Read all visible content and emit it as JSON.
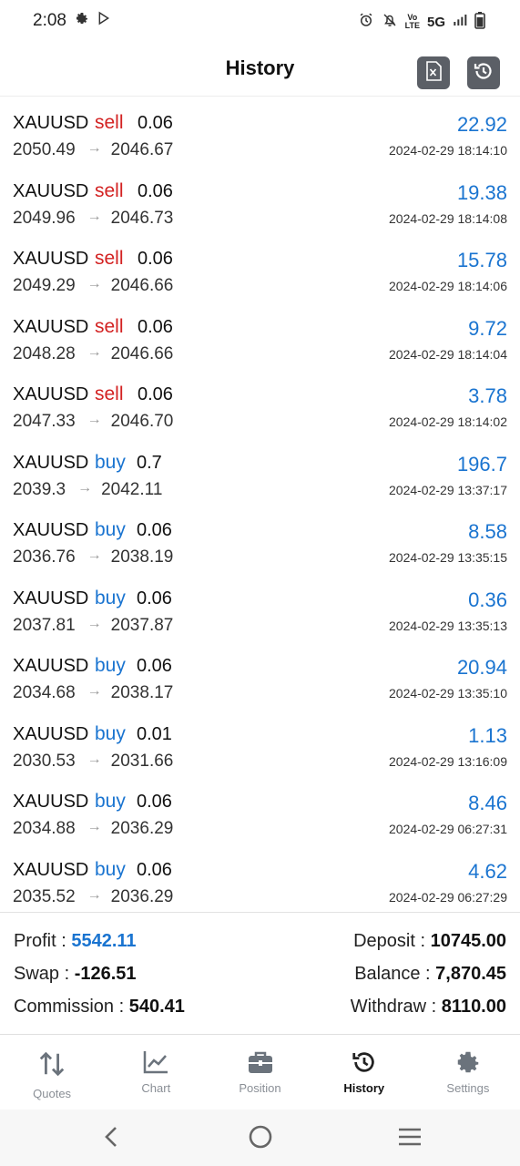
{
  "status_bar": {
    "time": "2:08",
    "network": "5G",
    "volte": "Vo\nLTE",
    "icons": [
      "gear-icon",
      "play-store-icon",
      "alarm-icon",
      "mute-icon",
      "volte-icon",
      "signal-icon",
      "battery-icon"
    ]
  },
  "header": {
    "title": "History",
    "buttons": [
      "export-excel-icon",
      "history-icon"
    ]
  },
  "colors": {
    "sell": "#d32222",
    "buy": "#1a74d0",
    "profit": "#1a74d0",
    "header_button": "#5b5f66"
  },
  "trades": [
    {
      "symbol": "XAUUSD",
      "side": "sell",
      "volume": "0.06",
      "open": "2050.49",
      "close": "2046.67",
      "profit": "22.92",
      "time": "2024-02-29 18:14:10"
    },
    {
      "symbol": "XAUUSD",
      "side": "sell",
      "volume": "0.06",
      "open": "2049.96",
      "close": "2046.73",
      "profit": "19.38",
      "time": "2024-02-29 18:14:08"
    },
    {
      "symbol": "XAUUSD",
      "side": "sell",
      "volume": "0.06",
      "open": "2049.29",
      "close": "2046.66",
      "profit": "15.78",
      "time": "2024-02-29 18:14:06"
    },
    {
      "symbol": "XAUUSD",
      "side": "sell",
      "volume": "0.06",
      "open": "2048.28",
      "close": "2046.66",
      "profit": "9.72",
      "time": "2024-02-29 18:14:04"
    },
    {
      "symbol": "XAUUSD",
      "side": "sell",
      "volume": "0.06",
      "open": "2047.33",
      "close": "2046.70",
      "profit": "3.78",
      "time": "2024-02-29 18:14:02"
    },
    {
      "symbol": "XAUUSD",
      "side": "buy",
      "volume": "0.7",
      "open": "2039.3",
      "close": "2042.11",
      "profit": "196.7",
      "time": "2024-02-29 13:37:17"
    },
    {
      "symbol": "XAUUSD",
      "side": "buy",
      "volume": "0.06",
      "open": "2036.76",
      "close": "2038.19",
      "profit": "8.58",
      "time": "2024-02-29 13:35:15"
    },
    {
      "symbol": "XAUUSD",
      "side": "buy",
      "volume": "0.06",
      "open": "2037.81",
      "close": "2037.87",
      "profit": "0.36",
      "time": "2024-02-29 13:35:13"
    },
    {
      "symbol": "XAUUSD",
      "side": "buy",
      "volume": "0.06",
      "open": "2034.68",
      "close": "2038.17",
      "profit": "20.94",
      "time": "2024-02-29 13:35:10"
    },
    {
      "symbol": "XAUUSD",
      "side": "buy",
      "volume": "0.01",
      "open": "2030.53",
      "close": "2031.66",
      "profit": "1.13",
      "time": "2024-02-29 13:16:09"
    },
    {
      "symbol": "XAUUSD",
      "side": "buy",
      "volume": "0.06",
      "open": "2034.88",
      "close": "2036.29",
      "profit": "8.46",
      "time": "2024-02-29 06:27:31"
    },
    {
      "symbol": "XAUUSD",
      "side": "buy",
      "volume": "0.06",
      "open": "2035.52",
      "close": "2036.29",
      "profit": "4.62",
      "time": "2024-02-29 06:27:29"
    }
  ],
  "summary": {
    "profit_label": "Profit :",
    "profit_value": "5542.11",
    "swap_label": "Swap :",
    "swap_value": "-126.51",
    "commission_label": "Commission :",
    "commission_value": "540.41",
    "deposit_label": "Deposit :",
    "deposit_value": "10745.00",
    "balance_label": "Balance :",
    "balance_value": "7,870.45",
    "withdraw_label": "Withdraw :",
    "withdraw_value": "8110.00"
  },
  "nav": {
    "items": [
      {
        "label": "Quotes",
        "icon": "quotes-icon"
      },
      {
        "label": "Chart",
        "icon": "chart-icon"
      },
      {
        "label": "Position",
        "icon": "briefcase-icon"
      },
      {
        "label": "History",
        "icon": "history-icon"
      },
      {
        "label": "Settings",
        "icon": "gear-icon"
      }
    ],
    "active": "History"
  },
  "arrow_glyph": "→"
}
